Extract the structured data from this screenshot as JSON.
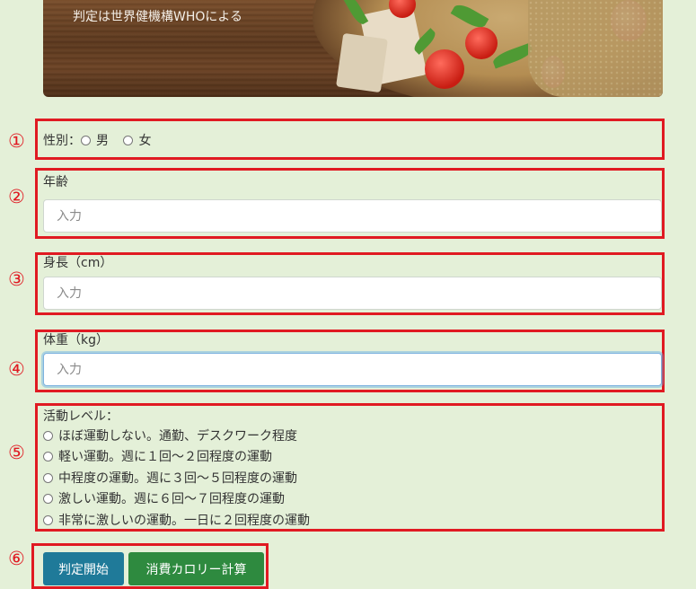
{
  "hero": {
    "caption": "判定は世界健機構WHOによる"
  },
  "markers": [
    "①",
    "②",
    "③",
    "④",
    "⑤",
    "⑥"
  ],
  "gender": {
    "label": "性別：",
    "options": [
      "男",
      "女"
    ]
  },
  "age": {
    "label": "年齢",
    "placeholder": "入力"
  },
  "height": {
    "label": "身長（cm）",
    "placeholder": "入力"
  },
  "weight": {
    "label": "体重（kg）",
    "placeholder": "入力"
  },
  "activity": {
    "label": "活動レベル：",
    "options": [
      "ほぼ運動しない。通勤、デスクワーク程度",
      "軽い運動。週に１回〜２回程度の運動",
      "中程度の運動。週に３回〜５回程度の運動",
      "激しい運動。週に６回〜７回程度の運動",
      "非常に激しいの運動。一日に２回程度の運動"
    ]
  },
  "buttons": {
    "judge": "判定開始",
    "calorie": "消費カロリー計算"
  },
  "colors": {
    "background": "#e4f0d8",
    "annotation": "#e01a22",
    "judge_button": "#1f7a99",
    "calorie_button": "#2e8a3f"
  }
}
